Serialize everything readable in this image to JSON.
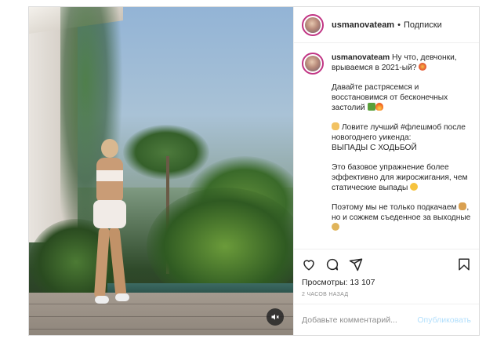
{
  "post": {
    "username": "usmanovateam",
    "separator": "•",
    "follow_label": "Подписки",
    "caption": [
      {
        "text": "Ну что, девчонки, врываемся в 2021-ый?",
        "emoji": "burst"
      },
      {
        "text": "Давайте растрясемся и восстановимся от бесконечных застолий",
        "emoji": "muscle-fire"
      },
      {
        "text": "Ловите лучший #флешмоб после новогоднего уикенда:\nВЫПАДЫ С ХОДЬБОЙ",
        "emoji": "point"
      },
      {
        "text": "Это базовое упражнение более эффективно для жиросжигания, чем статические выпады",
        "emoji": "smile"
      },
      {
        "text": "Поэтому мы не только подкачаем",
        "text2": ", но и сожжем съеденное за выходные",
        "emoji": "bread-rice"
      }
    ],
    "views_label": "Просмотры:",
    "views_value": "13 107",
    "time_ago": "2 ЧАСОВ НАЗАД",
    "comment_placeholder": "Добавьте комментарий...",
    "publish_label": "Опубликовать",
    "icons": [
      "heart-icon",
      "comment-icon",
      "share-icon",
      "bookmark-icon",
      "mute-icon"
    ]
  }
}
